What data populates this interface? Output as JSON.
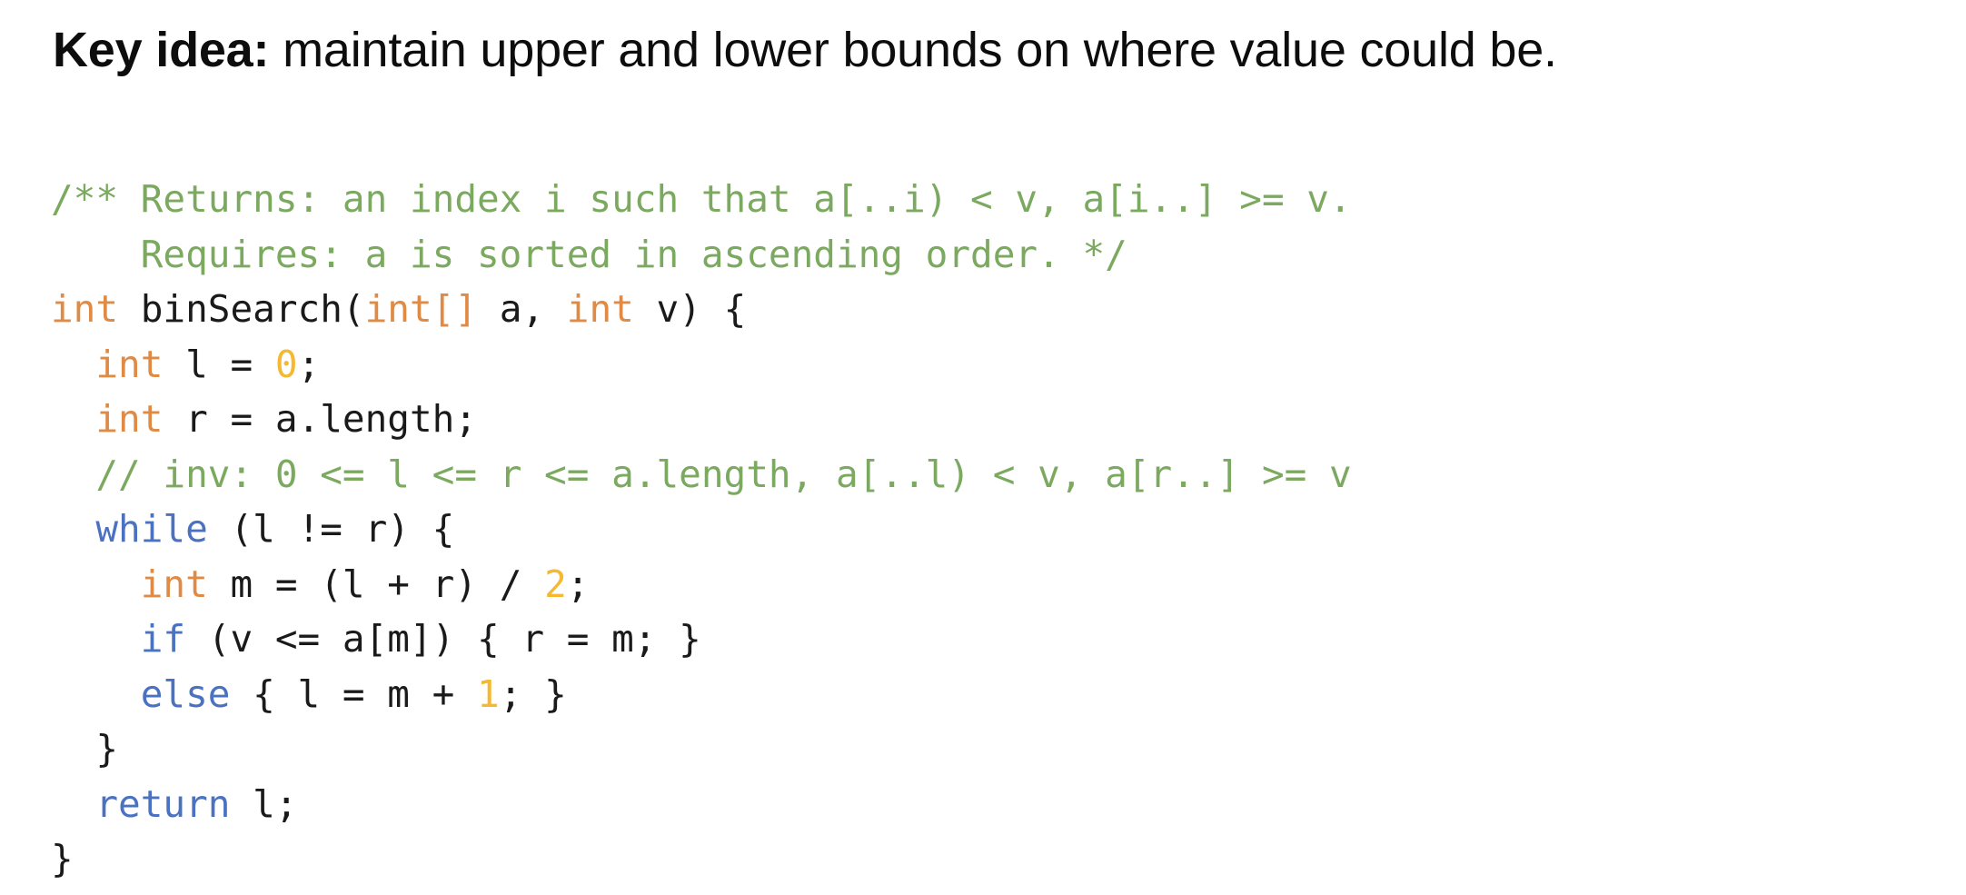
{
  "slide": {
    "background_color": "#ffffff",
    "heading": {
      "lead": "Key idea:",
      "rest": " maintain upper and lower bounds on where value could be."
    },
    "colors": {
      "comment": "#7ba95f",
      "type_keyword": "#e08b45",
      "control_keyword": "#4a72c0",
      "number_literal": "#f5b831",
      "plain_text": "#1a1a1a",
      "heading_text": "#0d0d0d"
    },
    "code": {
      "language": "java",
      "plain_text": "/** Returns: an index i such that a[..i) < v, a[i..] >= v.\n    Requires: a is sorted in ascending order. */\nint binSearch(int[] a, int v) {\n  int l = 0;\n  int r = a.length;\n  // inv: 0 <= l <= r <= a.length, a[..l) < v, a[r..] >= v\n  while (l != r) {\n    int m = (l + r) / 2;\n    if (v <= a[m]) { r = m; }\n    else { l = m + 1; }\n  }\n  return l;\n}",
      "lines": [
        {
          "id": "line-1",
          "tokens": [
            {
              "t": "/** Returns: an index i such that a[..i) < v, a[i..] >= v.",
              "c": "comment"
            }
          ]
        },
        {
          "id": "line-2",
          "tokens": [
            {
              "t": "    Requires: a is sorted in ascending order. */",
              "c": "comment"
            }
          ]
        },
        {
          "id": "line-3",
          "tokens": [
            {
              "t": "int",
              "c": "type"
            },
            {
              "t": " binSearch(",
              "c": "plain"
            },
            {
              "t": "int[]",
              "c": "type"
            },
            {
              "t": " a, ",
              "c": "plain"
            },
            {
              "t": "int",
              "c": "type"
            },
            {
              "t": " v) {",
              "c": "plain"
            }
          ]
        },
        {
          "id": "line-4",
          "tokens": [
            {
              "t": "  ",
              "c": "plain"
            },
            {
              "t": "int",
              "c": "type"
            },
            {
              "t": " l = ",
              "c": "plain"
            },
            {
              "t": "0",
              "c": "number"
            },
            {
              "t": ";",
              "c": "plain"
            }
          ]
        },
        {
          "id": "line-5",
          "tokens": [
            {
              "t": "  ",
              "c": "plain"
            },
            {
              "t": "int",
              "c": "type"
            },
            {
              "t": " r = a.length;",
              "c": "plain"
            }
          ]
        },
        {
          "id": "line-6",
          "tokens": [
            {
              "t": "  ",
              "c": "plain"
            },
            {
              "t": "// inv: 0 <= l <= r <= a.length, a[..l) < v, a[r..] >= v",
              "c": "comment"
            }
          ]
        },
        {
          "id": "line-7",
          "tokens": [
            {
              "t": "  ",
              "c": "plain"
            },
            {
              "t": "while",
              "c": "keyword"
            },
            {
              "t": " (l != r) {",
              "c": "plain"
            }
          ]
        },
        {
          "id": "line-8",
          "tokens": [
            {
              "t": "    ",
              "c": "plain"
            },
            {
              "t": "int",
              "c": "type"
            },
            {
              "t": " m = (l + r) / ",
              "c": "plain"
            },
            {
              "t": "2",
              "c": "number"
            },
            {
              "t": ";",
              "c": "plain"
            }
          ]
        },
        {
          "id": "line-9",
          "tokens": [
            {
              "t": "    ",
              "c": "plain"
            },
            {
              "t": "if",
              "c": "keyword"
            },
            {
              "t": " (v <= a[m]) { r = m; }",
              "c": "plain"
            }
          ]
        },
        {
          "id": "line-10",
          "tokens": [
            {
              "t": "    ",
              "c": "plain"
            },
            {
              "t": "else",
              "c": "keyword"
            },
            {
              "t": " { l = m + ",
              "c": "plain"
            },
            {
              "t": "1",
              "c": "number"
            },
            {
              "t": "; }",
              "c": "plain"
            }
          ]
        },
        {
          "id": "line-11",
          "tokens": [
            {
              "t": "  }",
              "c": "plain"
            }
          ]
        },
        {
          "id": "line-12",
          "tokens": [
            {
              "t": "  ",
              "c": "plain"
            },
            {
              "t": "return",
              "c": "keyword"
            },
            {
              "t": " l;",
              "c": "plain"
            }
          ]
        },
        {
          "id": "line-13",
          "tokens": [
            {
              "t": "}",
              "c": "plain"
            }
          ]
        }
      ]
    }
  }
}
